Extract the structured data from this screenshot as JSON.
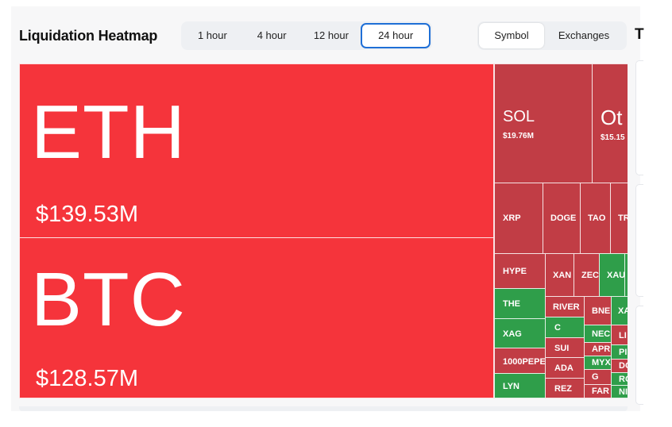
{
  "header": {
    "title": "Liquidation Heatmap",
    "time_tabs": [
      "1 hour",
      "4 hour",
      "12 hour",
      "24 hour"
    ],
    "active_time_tab": "24 hour",
    "view_tabs": [
      "Symbol",
      "Exchanges"
    ],
    "active_view_tab": "Symbol",
    "cut_off_heading": "T"
  },
  "colors": {
    "largest": "#f5343b",
    "red": "#c13d45",
    "green": "#2f9e4a",
    "active_tab_border": "#1f6fd6"
  },
  "heatmap": {
    "eth": {
      "symbol": "ETH",
      "value": "$139.53M"
    },
    "btc": {
      "symbol": "BTC",
      "value": "$128.57M"
    },
    "sol": {
      "symbol": "SOL",
      "value": "$19.76M"
    },
    "others": {
      "symbol": "Ot",
      "value": "$15.15"
    },
    "xrp": "XRP",
    "doge": "DOGE",
    "tao": "TAO",
    "tr": "TR",
    "hype": "HYPE",
    "xan": "XAN",
    "zec": "ZEC",
    "xau": "XAU",
    "the": "THE",
    "river": "RIVER",
    "bnb": "BNE",
    "xa": "XA",
    "xag": "XAG",
    "c": "C",
    "neo": "NEC",
    "li": "LI",
    "sui": "SUI",
    "apr": "APR",
    "pi": "PI",
    "pepe": "1000PEPE",
    "myx": "MYX",
    "do": "DO",
    "ada": "ADA",
    "g": "G",
    "ro": "RO",
    "lyn": "LYN",
    "rez": "REZ",
    "far": "FAR",
    "ni": "NI"
  }
}
